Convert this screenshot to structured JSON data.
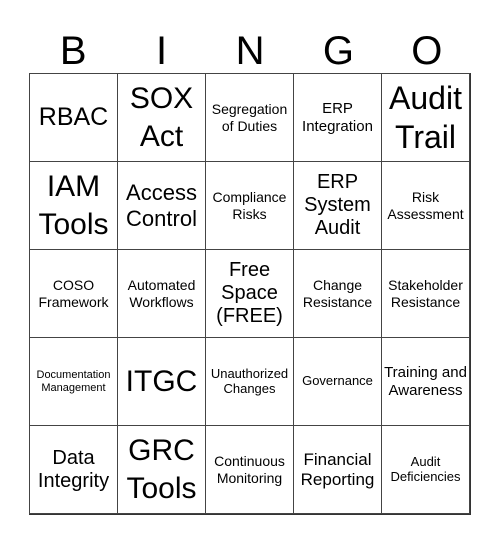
{
  "header": [
    "B",
    "I",
    "N",
    "G",
    "O"
  ],
  "cells": [
    "RBAC",
    "SOX Act",
    "Segregation of Duties",
    "ERP Integration",
    "Audit Trail",
    "IAM Tools",
    "Access Control",
    "Compliance Risks",
    "ERP System Audit",
    "Risk Assessment",
    "COSO Framework",
    "Automated Workflows",
    "Free Space (FREE)",
    "Change Resistance",
    "Stakeholder Resistance",
    "Documentation Management",
    "ITGC",
    "Unauthorized Changes",
    "Governance",
    "Training and Awareness",
    "Data Integrity",
    "GRC Tools",
    "Continuous Monitoring",
    "Financial Reporting",
    "Audit Deficiencies"
  ]
}
